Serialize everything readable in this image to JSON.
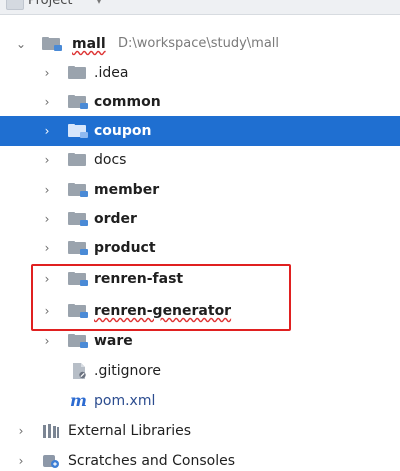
{
  "panel": {
    "title": "Project",
    "colors": {
      "selected_bg": "#1f6fd1",
      "highlight_box": "#e02020",
      "folder": "#9aa3ad",
      "module_marker": "#4a8ad6",
      "maven": "#2c6bd1"
    }
  },
  "tree": {
    "root": {
      "label": "mall",
      "path": "D:\\workspace\\study\\mall",
      "expanded": true,
      "icon": "module-folder-icon"
    },
    "items": [
      {
        "label": ".idea",
        "icon": "folder-icon",
        "expandable": true
      },
      {
        "label": "common",
        "icon": "module-folder-icon",
        "expandable": true,
        "bold": true
      },
      {
        "label": "coupon",
        "icon": "module-folder-icon",
        "expandable": true,
        "bold": true,
        "selected": true
      },
      {
        "label": "docs",
        "icon": "folder-icon",
        "expandable": true
      },
      {
        "label": "member",
        "icon": "module-folder-icon",
        "expandable": true,
        "bold": true
      },
      {
        "label": "order",
        "icon": "module-folder-icon",
        "expandable": true,
        "bold": true
      },
      {
        "label": "product",
        "icon": "module-folder-icon",
        "expandable": true,
        "bold": true
      },
      {
        "label": "renren-fast",
        "icon": "module-folder-icon",
        "expandable": true,
        "bold": true
      },
      {
        "label": "renren-generator",
        "icon": "module-folder-icon",
        "expandable": true,
        "bold": true
      },
      {
        "label": "ware",
        "icon": "module-folder-icon",
        "expandable": true,
        "bold": true
      },
      {
        "label": ".gitignore",
        "icon": "gitignore-icon",
        "expandable": false
      },
      {
        "label": "pom.xml",
        "icon": "maven-icon",
        "expandable": false
      }
    ],
    "bottom": [
      {
        "label": "External Libraries",
        "icon": "libraries-icon"
      },
      {
        "label": "Scratches and Consoles",
        "icon": "scratches-icon"
      }
    ]
  }
}
